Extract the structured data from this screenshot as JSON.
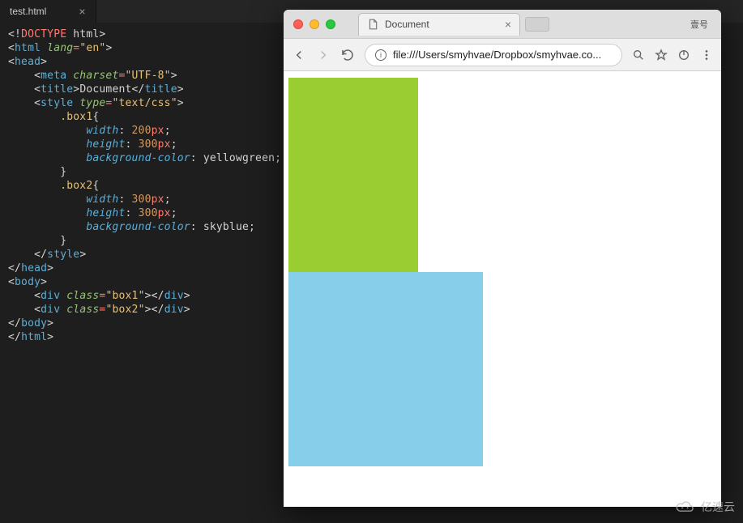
{
  "editor": {
    "tab": {
      "filename": "test.html"
    },
    "code": {
      "doctype": "DOCTYPE",
      "html": "html",
      "lang_attr": "lang",
      "lang_val": "en",
      "head": "head",
      "meta": "meta",
      "charset_attr": "charset",
      "charset_val": "UTF-8",
      "title": "title",
      "title_text": "Document",
      "style": "style",
      "type_attr": "type",
      "type_val": "text/css",
      "sel_box1": ".box1",
      "sel_box2": ".box2",
      "prop_width": "width",
      "prop_height": "height",
      "prop_bg": "background-color",
      "val_200px_num": "200",
      "val_300px_num": "300",
      "unit_px": "px",
      "val_yg": "yellowgreen",
      "val_sb": "skyblue",
      "body": "body",
      "div": "div",
      "class_attr": "class",
      "class_box1": "box1",
      "class_box2": "box2"
    }
  },
  "browser": {
    "tab_title": "Document",
    "url": "file:///Users/smyhvae/Dropbox/smyhvae.co...",
    "profile_label": "壹号"
  },
  "watermark": {
    "text": "亿速云"
  }
}
